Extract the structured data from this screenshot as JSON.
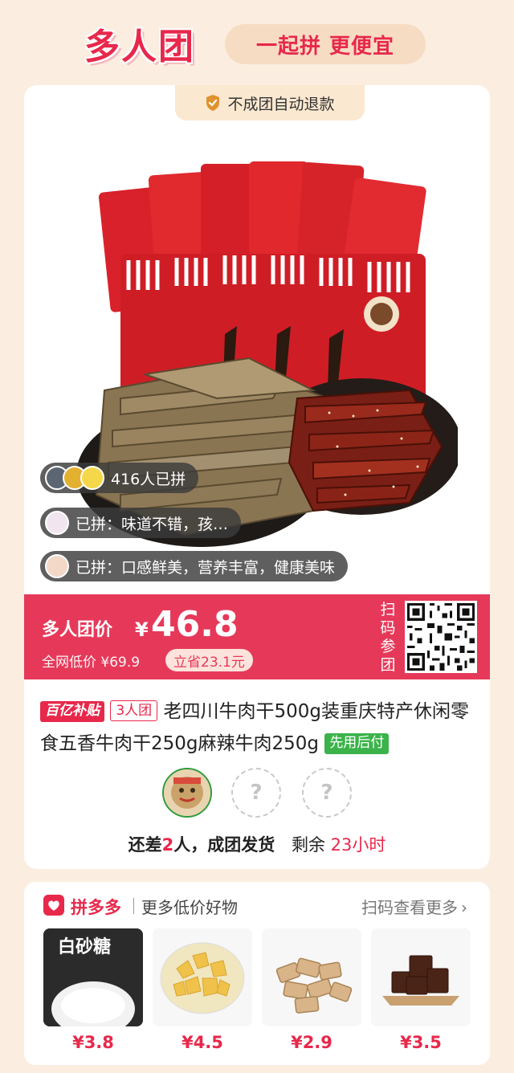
{
  "header": {
    "title": "多人团",
    "slogan": "一起拼 更便宜"
  },
  "badge": {
    "refund_text": "不成团自动退款"
  },
  "overlays": {
    "count_text": "416人已拼",
    "review1": "已拼：味道不错，孩…",
    "review2": "已拼：口感鲜美，营养丰富，健康美味"
  },
  "price": {
    "label": "多人团价",
    "currency": "¥",
    "value": "46.8",
    "original": "全网低价 ¥69.9",
    "save": "立省23.1元",
    "scan_label": "扫码参团"
  },
  "product": {
    "tag_subsidy": "百亿补贴",
    "tag_group": "3人团",
    "title": "老四川牛肉干500g装重庆特产休闲零食五香牛肉干250g麻辣牛肉250g",
    "tag_pay": "先用后付"
  },
  "group": {
    "status_prefix": "还差",
    "missing": "2",
    "status_mid": "人，成团发货",
    "remain_label": "剩余",
    "remain_time": "23小时",
    "placeholder": "?"
  },
  "more": {
    "brand": "拼多多",
    "title": "更多低价好物",
    "link": "扫码查看更多",
    "items": [
      {
        "price": "¥3.8",
        "label": "白砂糖"
      },
      {
        "price": "¥4.5"
      },
      {
        "price": "¥2.9"
      },
      {
        "price": "¥3.5"
      }
    ]
  },
  "colors": {
    "accent": "#e8284b",
    "price_bar": "#e6395a",
    "background": "#fbeee0",
    "pay_tag": "#3bb34a"
  }
}
